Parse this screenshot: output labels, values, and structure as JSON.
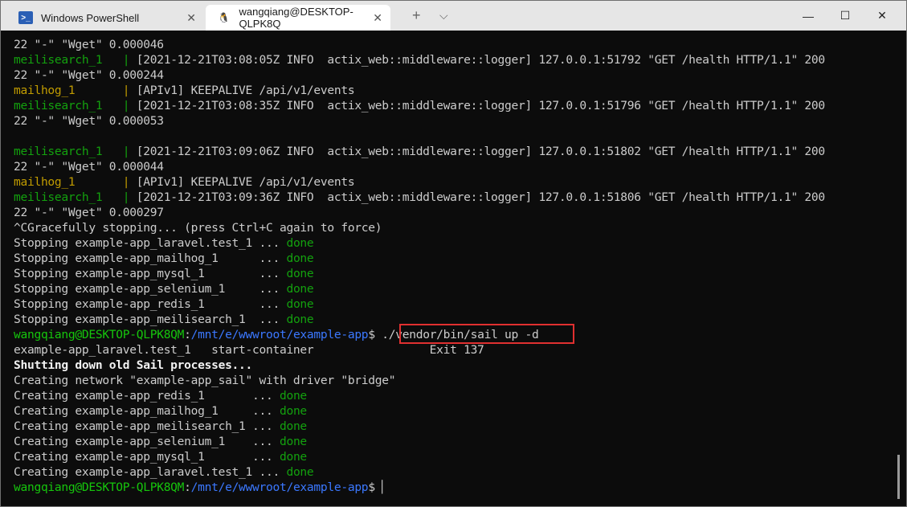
{
  "tabs": [
    {
      "label": "Windows PowerShell",
      "icon": "powershell-icon"
    },
    {
      "label": "wangqiang@DESKTOP-QLPK8Q",
      "icon": "linux-penguin-icon"
    }
  ],
  "titlebar": {
    "new_tab": "+",
    "dropdown": "⌵",
    "minimize": "—",
    "maximize": "☐",
    "close": "✕",
    "tab_close": "✕"
  },
  "lines": [
    [
      [
        "22 \"-\" \"Wget\" 0.000046",
        ""
      ]
    ],
    [
      [
        "meilisearch_1   ",
        "g"
      ],
      [
        "| ",
        "g"
      ],
      [
        "[2021-12-21T03:08:05Z INFO  actix_web::middleware::logger] 127.0.0.1:51792 \"GET /health HTTP/1.1\" 200",
        ""
      ]
    ],
    [
      [
        "22 \"-\" \"Wget\" 0.000244",
        ""
      ]
    ],
    [
      [
        "mailhog_1       ",
        "y"
      ],
      [
        "| ",
        "y"
      ],
      [
        "[APIv1] KEEPALIVE /api/v1/events",
        ""
      ]
    ],
    [
      [
        "meilisearch_1   ",
        "g"
      ],
      [
        "| ",
        "g"
      ],
      [
        "[2021-12-21T03:08:35Z INFO  actix_web::middleware::logger] 127.0.0.1:51796 \"GET /health HTTP/1.1\" 200",
        ""
      ]
    ],
    [
      [
        "22 \"-\" \"Wget\" 0.000053",
        ""
      ]
    ],
    [
      [
        "",
        ""
      ]
    ],
    [
      [
        "meilisearch_1   ",
        "g"
      ],
      [
        "| ",
        "g"
      ],
      [
        "[2021-12-21T03:09:06Z INFO  actix_web::middleware::logger] 127.0.0.1:51802 \"GET /health HTTP/1.1\" 200",
        ""
      ]
    ],
    [
      [
        "22 \"-\" \"Wget\" 0.000044",
        ""
      ]
    ],
    [
      [
        "mailhog_1       ",
        "y"
      ],
      [
        "| ",
        "y"
      ],
      [
        "[APIv1] KEEPALIVE /api/v1/events",
        ""
      ]
    ],
    [
      [
        "meilisearch_1   ",
        "g"
      ],
      [
        "| ",
        "g"
      ],
      [
        "[2021-12-21T03:09:36Z INFO  actix_web::middleware::logger] 127.0.0.1:51806 \"GET /health HTTP/1.1\" 200",
        ""
      ]
    ],
    [
      [
        "22 \"-\" \"Wget\" 0.000297",
        ""
      ]
    ],
    [
      [
        "^CGracefully stopping... (press Ctrl+C again to force)",
        ""
      ]
    ],
    [
      [
        "Stopping example-app_laravel.test_1 ... ",
        ""
      ],
      [
        "done",
        "g"
      ]
    ],
    [
      [
        "Stopping example-app_mailhog_1      ... ",
        ""
      ],
      [
        "done",
        "g"
      ]
    ],
    [
      [
        "Stopping example-app_mysql_1        ... ",
        ""
      ],
      [
        "done",
        "g"
      ]
    ],
    [
      [
        "Stopping example-app_selenium_1     ... ",
        ""
      ],
      [
        "done",
        "g"
      ]
    ],
    [
      [
        "Stopping example-app_redis_1        ... ",
        ""
      ],
      [
        "done",
        "g"
      ]
    ],
    [
      [
        "Stopping example-app_meilisearch_1  ... ",
        ""
      ],
      [
        "done",
        "g"
      ]
    ],
    [
      [
        "wangqiang@DESKTOP-QLPK8QM",
        "gb"
      ],
      [
        ":",
        ""
      ],
      [
        "/mnt/e/wwwroot/example-app",
        "b"
      ],
      [
        "$ ./vendor/bin/sail up -d",
        ""
      ]
    ],
    [
      [
        "example-app_laravel.test_1   start-container                 Exit 137",
        ""
      ]
    ],
    [
      [
        "Shutting down old Sail processes...",
        "w"
      ]
    ],
    [
      [
        "Creating network \"example-app_sail\" with driver \"bridge\"",
        ""
      ]
    ],
    [
      [
        "Creating example-app_redis_1       ... ",
        ""
      ],
      [
        "done",
        "g"
      ]
    ],
    [
      [
        "Creating example-app_mailhog_1     ... ",
        ""
      ],
      [
        "done",
        "g"
      ]
    ],
    [
      [
        "Creating example-app_meilisearch_1 ... ",
        ""
      ],
      [
        "done",
        "g"
      ]
    ],
    [
      [
        "Creating example-app_selenium_1    ... ",
        ""
      ],
      [
        "done",
        "g"
      ]
    ],
    [
      [
        "Creating example-app_mysql_1       ... ",
        ""
      ],
      [
        "done",
        "g"
      ]
    ],
    [
      [
        "Creating example-app_laravel.test_1 ... ",
        ""
      ],
      [
        "done",
        "g"
      ]
    ],
    [
      [
        "wangqiang@DESKTOP-QLPK8QM",
        "gb"
      ],
      [
        ":",
        ""
      ],
      [
        "/mnt/e/wwwroot/example-app",
        "b"
      ],
      [
        "$ ",
        ""
      ],
      [
        "▏",
        ""
      ]
    ]
  ]
}
